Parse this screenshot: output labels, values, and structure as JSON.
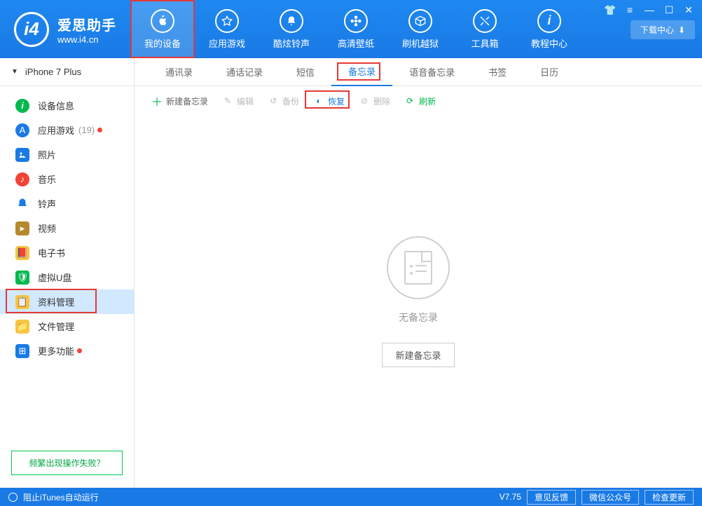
{
  "header": {
    "logo_mark": "i4",
    "app_name": "爱思助手",
    "app_url": "www.i4.cn",
    "download_center": "下载中心",
    "nav": [
      {
        "label": "我的设备",
        "icon": "apple"
      },
      {
        "label": "应用游戏",
        "icon": "appstore"
      },
      {
        "label": "酷炫铃声",
        "icon": "bell"
      },
      {
        "label": "高清壁纸",
        "icon": "flower"
      },
      {
        "label": "刷机越狱",
        "icon": "box"
      },
      {
        "label": "工具箱",
        "icon": "tools"
      },
      {
        "label": "教程中心",
        "icon": "info"
      }
    ]
  },
  "sidebar": {
    "device_name": "iPhone 7 Plus",
    "help_text": "频繁出现操作失败？",
    "items": [
      {
        "label": "设备信息",
        "color": "#00b84d"
      },
      {
        "label": "应用游戏",
        "count": "(19)",
        "dot": true,
        "color": "#1a7ae5"
      },
      {
        "label": "照片",
        "color": "#1a7ae5"
      },
      {
        "label": "音乐",
        "color": "#f44336"
      },
      {
        "label": "铃声",
        "color": "#1a7ae5"
      },
      {
        "label": "视频",
        "color": "#b58a2e"
      },
      {
        "label": "电子书",
        "color": "#f5c542"
      },
      {
        "label": "虚拟U盘",
        "color": "#00b84d"
      },
      {
        "label": "资料管理",
        "color": "#f5c542",
        "active": true
      },
      {
        "label": "文件管理",
        "color": "#f5c542"
      },
      {
        "label": "更多功能",
        "dot": true,
        "color": "#1a7ae5"
      }
    ]
  },
  "tabs": [
    "通讯录",
    "通话记录",
    "短信",
    "备忘录",
    "语音备忘录",
    "书签",
    "日历"
  ],
  "active_tab": "备忘录",
  "toolbar": {
    "new": "新建备忘录",
    "edit": "编辑",
    "backup": "备份",
    "restore": "恢复",
    "delete": "删除",
    "refresh": "刷新"
  },
  "empty": {
    "title": "无备忘录",
    "button": "新建备忘录"
  },
  "footer": {
    "itunes": "阻止iTunes自动运行",
    "version": "V7.75",
    "feedback": "意见反馈",
    "wechat": "微信公众号",
    "update": "检查更新"
  }
}
